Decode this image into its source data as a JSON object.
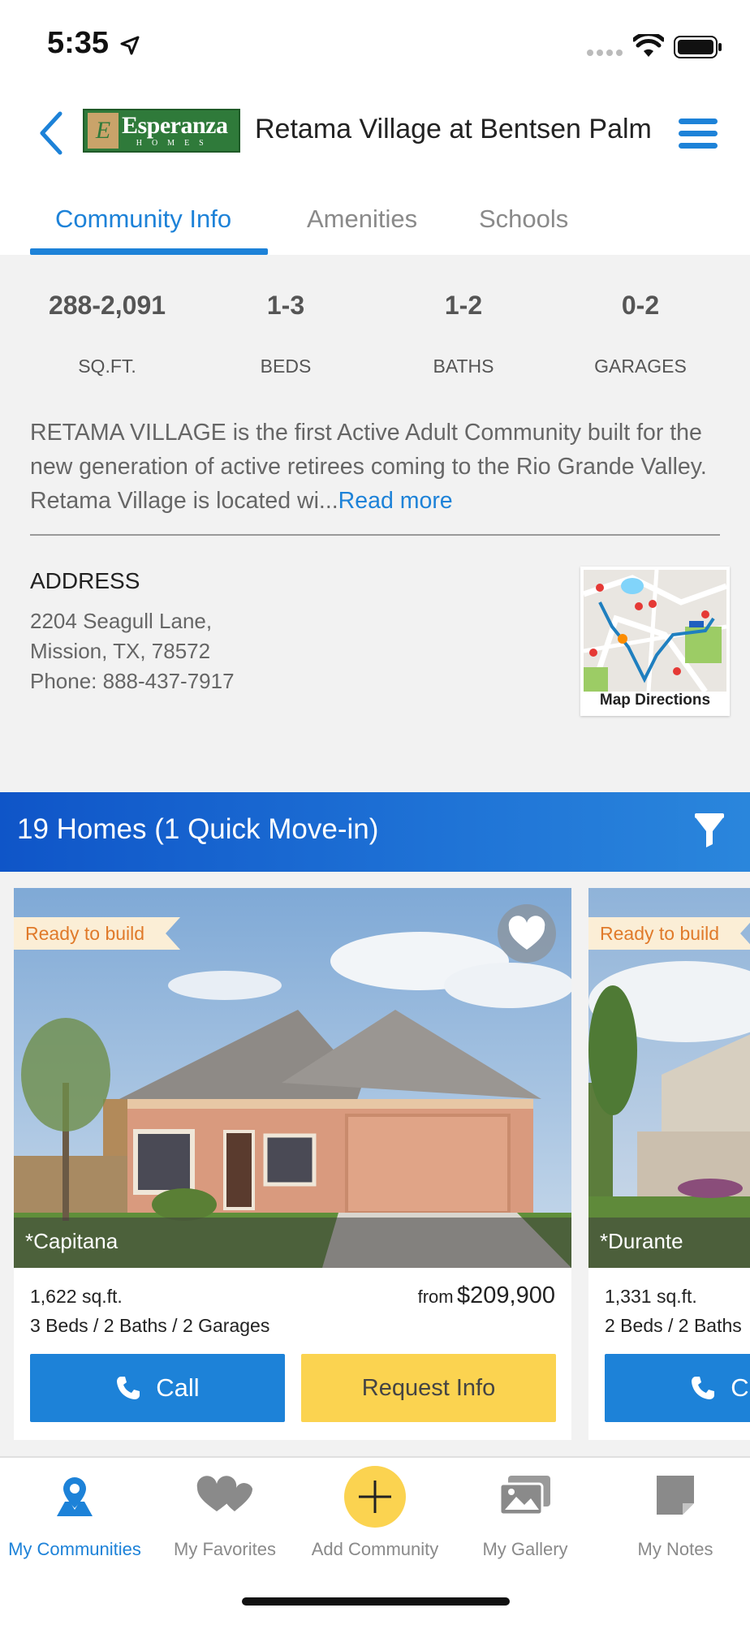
{
  "status_bar": {
    "time": "5:35"
  },
  "header": {
    "logo": {
      "brand": "Esperanza",
      "sub": "HOMES"
    },
    "title": "Retama Village at Bentsen Palm"
  },
  "tabs": [
    {
      "label": "Community Info",
      "active": true
    },
    {
      "label": "Amenities",
      "active": false
    },
    {
      "label": "Schools",
      "active": false
    }
  ],
  "stats": [
    {
      "value": "288-2,091",
      "label": "SQ.FT."
    },
    {
      "value": "1-3",
      "label": "BEDS"
    },
    {
      "value": "1-2",
      "label": "BATHS"
    },
    {
      "value": "0-2",
      "label": "GARAGES"
    }
  ],
  "description": {
    "text": "RETAMA VILLAGE is the first Active Adult Community built for the new generation of active retirees coming to the Rio Grande Valley. Retama Village is located wi...",
    "read_more": "Read more"
  },
  "address": {
    "heading": "ADDRESS",
    "line1": "2204 Seagull Lane,",
    "line2": "Mission, TX, 78572",
    "phone": "Phone: 888-437-7917",
    "map_label": "Map Directions"
  },
  "homes": {
    "title": "19 Homes (1 Quick Move-in)",
    "cards": [
      {
        "ribbon": "Ready to build",
        "name": "*Capitana",
        "sqft": "1,622 sq.ft.",
        "specs": "3 Beds / 2 Baths / 2 Garages",
        "price_prefix": "from",
        "price": "$209,900",
        "call_label": "Call",
        "request_label": "Request Info"
      },
      {
        "ribbon": "Ready to build",
        "name": "*Durante",
        "sqft": "1,331 sq.ft.",
        "specs": "2 Beds / 2 Baths",
        "call_label": "Call"
      }
    ]
  },
  "bottom_nav": [
    {
      "label": "My Communities",
      "icon": "map-pin-icon",
      "active": true
    },
    {
      "label": "My Favorites",
      "icon": "hearts-icon",
      "active": false
    },
    {
      "label": "Add Community",
      "icon": "plus-icon",
      "active": false
    },
    {
      "label": "My Gallery",
      "icon": "gallery-icon",
      "active": false
    },
    {
      "label": "My Notes",
      "icon": "note-icon",
      "active": false
    }
  ],
  "colors": {
    "accent": "#1d82d8",
    "button_yellow": "#fbd350",
    "ribbon_text": "#e07a2a"
  }
}
